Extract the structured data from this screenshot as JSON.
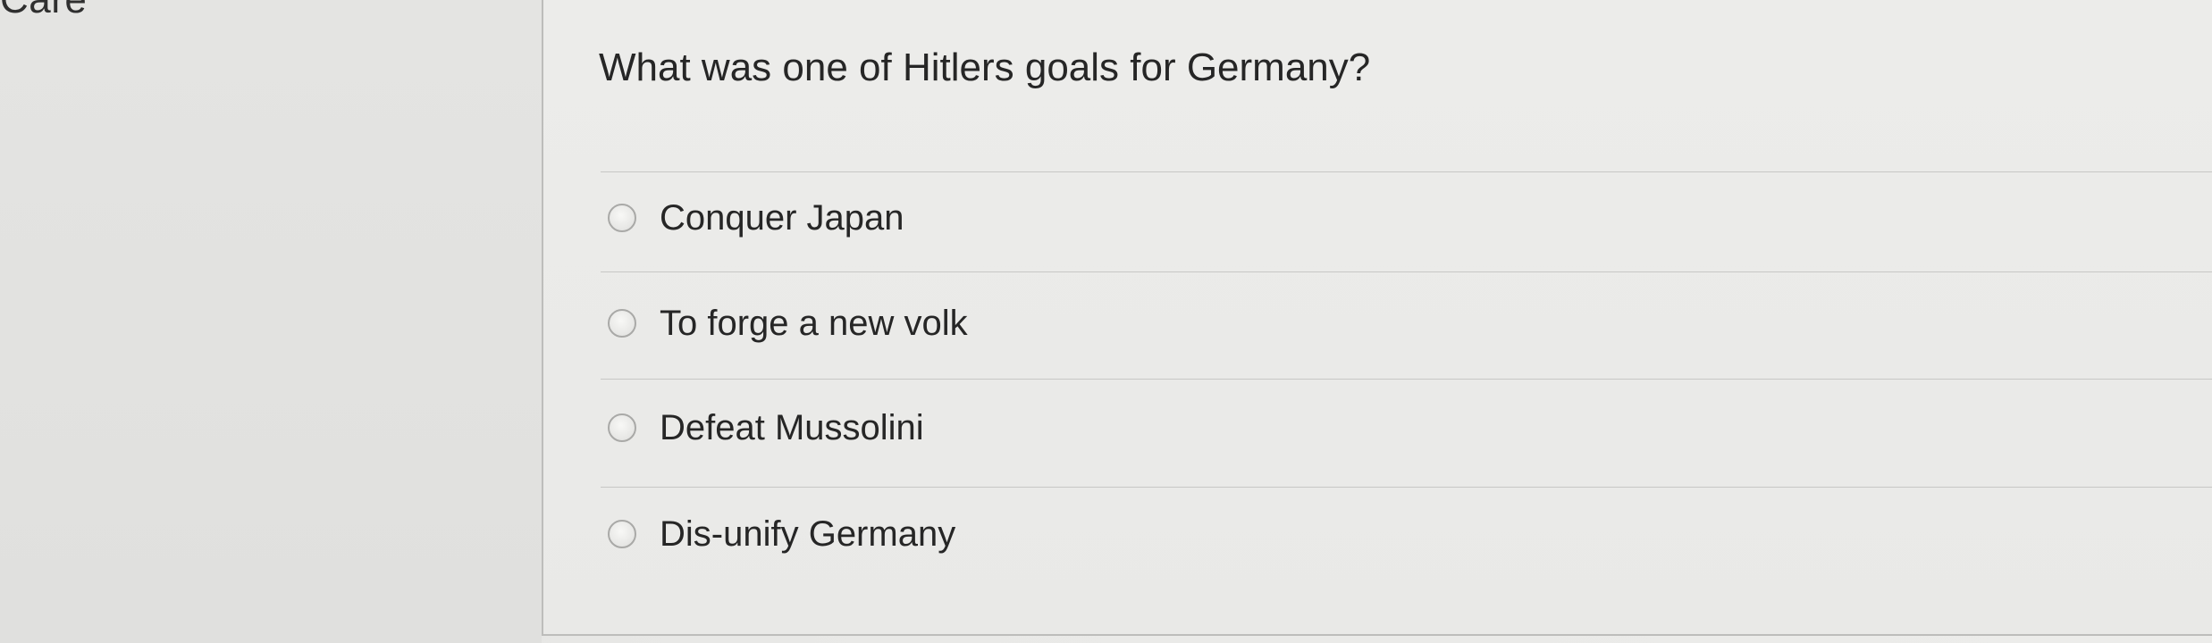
{
  "left": {
    "corner_text": "Care"
  },
  "question": {
    "text": "What was one of Hitlers goals for Germany?",
    "options": [
      {
        "label": "Conquer Japan"
      },
      {
        "label": "To forge a new volk"
      },
      {
        "label": "Defeat Mussolini"
      },
      {
        "label": "Dis-unify Germany"
      }
    ]
  }
}
